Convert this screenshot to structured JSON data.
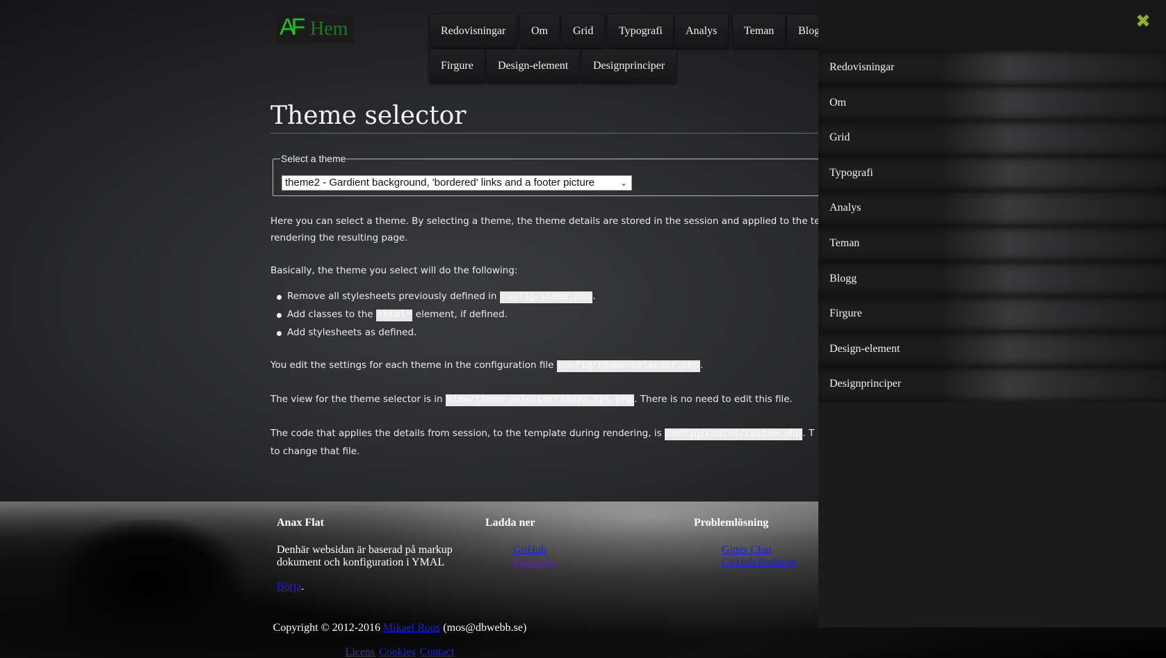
{
  "header": {
    "logo": {
      "initials": "AF",
      "text": "Hem"
    },
    "nav": [
      "Redovisningar",
      "Om",
      "Grid",
      "Typografi",
      "Analys",
      "Teman",
      "Blogg",
      "Firgure",
      "Design-element",
      "Designprinciper"
    ]
  },
  "main": {
    "title": "Theme selector",
    "fieldset_legend": "Select a theme",
    "select_value": "theme2 - Gardient background, 'bordered' links and a footer picture",
    "intro_a": "Here you can select a theme. By selecting a theme, the theme details are stored in the session and applied to the template",
    "intro_b": "rendering the resulting page.",
    "basically": "Basically, the theme you select will do the following:",
    "bullets": {
      "b1_pre": "Remove all stylesheets previously defined in ",
      "b1_code": "config/theme.php",
      "b1_post": ".",
      "b2_pre": "Add classes to the ",
      "b2_code": "<html>",
      "b2_post": " element, if defined.",
      "b3": "Add stylesheets as defined."
    },
    "edit_pre": "You edit the settings for each theme in the configuration file ",
    "edit_code": "config/theme-selecotr.php",
    "edit_post": ".",
    "view_pre": "The view for the theme selector is in ",
    "view_code": "view/theme-selector/index.tpl.php",
    "view_post": ". There is no need to edit this file.",
    "code_pre": "The code that applies the details from session, to the template during rendering, is ",
    "code_code": "config/routes/custom.php",
    "code_post": ". T",
    "code_tail": "to change that file."
  },
  "footer": {
    "col1": {
      "heading": "Anax Flat",
      "desc": "Denhär websidan är baserad på markup dokument och konfiguration i YMAL",
      "link": "Börja",
      "link_suffix": "."
    },
    "col2": {
      "heading": "Ladda ner",
      "links": [
        "GitHub",
        "Packagist"
      ]
    },
    "col3": {
      "heading": "Problemlösning",
      "links": [
        "Gitter Chat",
        "GitHub Problem"
      ]
    },
    "copyright_pre": "Copyright © 2012-2016 ",
    "copyright_author": "Mikael Roos",
    "copyright_post": " (mos@dbwebb.se)",
    "bottom_links": [
      "Licens",
      "Cookies",
      "Contact"
    ]
  },
  "sidepanel": {
    "close_icon": "close-x-icon",
    "items": [
      "Redovisningar",
      "Om",
      "Grid",
      "Typografi",
      "Analys",
      "Teman",
      "Blogg",
      "Firgure",
      "Design-element",
      "Designprinciper"
    ]
  },
  "colors": {
    "accent_green": "#1fc01f",
    "close_green": "#8ab030",
    "link_blue": "#2020e0"
  }
}
